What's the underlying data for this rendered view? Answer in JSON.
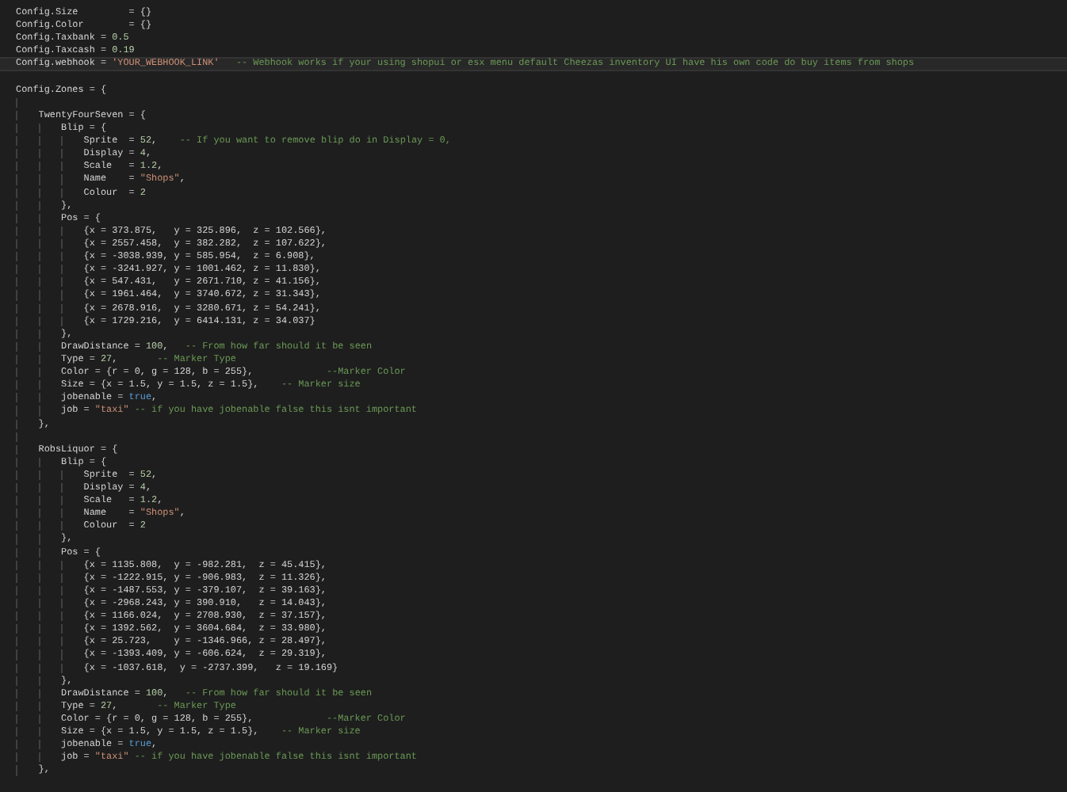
{
  "editor": {
    "lines": [
      {
        "current": false,
        "tokens": [
          {
            "kind": "code",
            "text": "Config.Size         = {}"
          }
        ]
      },
      {
        "current": false,
        "tokens": [
          {
            "kind": "code",
            "text": "Config.Color        = {}"
          }
        ]
      },
      {
        "current": false,
        "tokens": [
          {
            "kind": "code",
            "text": "Config.Taxbank = "
          },
          {
            "kind": "number",
            "text": "0.5"
          }
        ]
      },
      {
        "current": false,
        "tokens": [
          {
            "kind": "code",
            "text": "Config.Taxcash = "
          },
          {
            "kind": "number",
            "text": "0.19"
          }
        ]
      },
      {
        "current": true,
        "tokens": [
          {
            "kind": "code",
            "text": "Config.webhook = "
          },
          {
            "kind": "string",
            "text": "'YOUR_WEBHOOK_LINK'"
          },
          {
            "kind": "comment",
            "text": "   -- Webhook works if your using shopui or esx menu default Cheezas inventory UI have his own code do buy items from shops"
          }
        ]
      },
      {
        "current": false
      },
      {
        "current": false,
        "tokens": [
          {
            "kind": "code",
            "text": "Config.Zones = {"
          }
        ]
      },
      {
        "current": false
      },
      {
        "current": false,
        "tokens": [
          {
            "kind": "code",
            "text": "    TwentyFourSeven = {"
          }
        ]
      },
      {
        "current": false,
        "tokens": [
          {
            "kind": "code",
            "text": "        Blip = {"
          }
        ]
      },
      {
        "current": false,
        "tokens": [
          {
            "kind": "code",
            "text": "            Sprite  = "
          },
          {
            "kind": "number",
            "text": "52"
          },
          {
            "kind": "code",
            "text": ","
          },
          {
            "kind": "comment",
            "text": "    -- If you want to remove blip do in Display = 0,"
          }
        ]
      },
      {
        "current": false,
        "tokens": [
          {
            "kind": "code",
            "text": "            Display = "
          },
          {
            "kind": "number",
            "text": "4"
          },
          {
            "kind": "code",
            "text": ","
          }
        ]
      },
      {
        "current": false,
        "tokens": [
          {
            "kind": "code",
            "text": "            Scale   = "
          },
          {
            "kind": "number",
            "text": "1.2"
          },
          {
            "kind": "code",
            "text": ","
          }
        ]
      },
      {
        "current": false,
        "tokens": [
          {
            "kind": "code",
            "text": "            Name    = "
          },
          {
            "kind": "string",
            "text": "\"Shops\""
          },
          {
            "kind": "code",
            "text": ","
          }
        ]
      },
      {
        "current": false,
        "tokens": [
          {
            "kind": "code",
            "text": "            Colour  = "
          },
          {
            "kind": "number",
            "text": "2"
          }
        ]
      },
      {
        "current": false,
        "tokens": [
          {
            "kind": "code",
            "text": "        },"
          }
        ]
      },
      {
        "current": false,
        "tokens": [
          {
            "kind": "code",
            "text": "        Pos = {"
          }
        ]
      },
      {
        "current": false,
        "tokens": [
          {
            "kind": "code",
            "text": "            {x = 373.875,   y = 325.896,  z = 102.566},"
          }
        ]
      },
      {
        "current": false,
        "tokens": [
          {
            "kind": "code",
            "text": "            {x = 2557.458,  y = 382.282,  z = 107.622},"
          }
        ]
      },
      {
        "current": false,
        "tokens": [
          {
            "kind": "code",
            "text": "            {x = -3038.939, y = 585.954,  z = 6.908},"
          }
        ]
      },
      {
        "current": false,
        "tokens": [
          {
            "kind": "code",
            "text": "            {x = -3241.927, y = 1001.462, z = 11.830},"
          }
        ]
      },
      {
        "current": false,
        "tokens": [
          {
            "kind": "code",
            "text": "            {x = 547.431,   y = 2671.710, z = 41.156},"
          }
        ]
      },
      {
        "current": false,
        "tokens": [
          {
            "kind": "code",
            "text": "            {x = 1961.464,  y = 3740.672, z = 31.343},"
          }
        ]
      },
      {
        "current": false,
        "tokens": [
          {
            "kind": "code",
            "text": "            {x = 2678.916,  y = 3280.671, z = 54.241},"
          }
        ]
      },
      {
        "current": false,
        "tokens": [
          {
            "kind": "code",
            "text": "            {x = 1729.216,  y = 6414.131, z = 34.037}"
          }
        ]
      },
      {
        "current": false,
        "tokens": [
          {
            "kind": "code",
            "text": "        },"
          }
        ]
      },
      {
        "current": false,
        "tokens": [
          {
            "kind": "code",
            "text": "        DrawDistance = "
          },
          {
            "kind": "number",
            "text": "100"
          },
          {
            "kind": "code",
            "text": ","
          },
          {
            "kind": "comment",
            "text": "   -- From how far should it be seen"
          }
        ]
      },
      {
        "current": false,
        "tokens": [
          {
            "kind": "code",
            "text": "        Type = "
          },
          {
            "kind": "number",
            "text": "27"
          },
          {
            "kind": "code",
            "text": ","
          },
          {
            "kind": "comment",
            "text": "       -- Marker Type"
          }
        ]
      },
      {
        "current": false,
        "tokens": [
          {
            "kind": "code",
            "text": "        Color = {r = 0, g = 128, b = 255},"
          },
          {
            "kind": "comment",
            "text": "             --Marker Color"
          }
        ]
      },
      {
        "current": false,
        "tokens": [
          {
            "kind": "code",
            "text": "        Size = {x = 1.5, y = 1.5, z = 1.5},"
          },
          {
            "kind": "comment",
            "text": "    -- Marker size"
          }
        ]
      },
      {
        "current": false,
        "tokens": [
          {
            "kind": "code",
            "text": "        jobenable = "
          },
          {
            "kind": "keyword",
            "text": "true"
          },
          {
            "kind": "code",
            "text": ","
          }
        ]
      },
      {
        "current": false,
        "tokens": [
          {
            "kind": "code",
            "text": "        job = "
          },
          {
            "kind": "string",
            "text": "\"taxi\""
          },
          {
            "kind": "comment",
            "text": " -- if you have jobenable false this isnt important"
          }
        ]
      },
      {
        "current": false,
        "tokens": [
          {
            "kind": "code",
            "text": "    },"
          }
        ]
      },
      {
        "current": false
      },
      {
        "current": false,
        "tokens": [
          {
            "kind": "code",
            "text": "    RobsLiquor = {"
          }
        ]
      },
      {
        "current": false,
        "tokens": [
          {
            "kind": "code",
            "text": "        Blip = {"
          }
        ]
      },
      {
        "current": false,
        "tokens": [
          {
            "kind": "code",
            "text": "            Sprite  = "
          },
          {
            "kind": "number",
            "text": "52"
          },
          {
            "kind": "code",
            "text": ","
          }
        ]
      },
      {
        "current": false,
        "tokens": [
          {
            "kind": "code",
            "text": "            Display = "
          },
          {
            "kind": "number",
            "text": "4"
          },
          {
            "kind": "code",
            "text": ","
          }
        ]
      },
      {
        "current": false,
        "tokens": [
          {
            "kind": "code",
            "text": "            Scale   = "
          },
          {
            "kind": "number",
            "text": "1.2"
          },
          {
            "kind": "code",
            "text": ","
          }
        ]
      },
      {
        "current": false,
        "tokens": [
          {
            "kind": "code",
            "text": "            Name    = "
          },
          {
            "kind": "string",
            "text": "\"Shops\""
          },
          {
            "kind": "code",
            "text": ","
          }
        ]
      },
      {
        "current": false,
        "tokens": [
          {
            "kind": "code",
            "text": "            Colour  = "
          },
          {
            "kind": "number",
            "text": "2"
          }
        ]
      },
      {
        "current": false,
        "tokens": [
          {
            "kind": "code",
            "text": "        },"
          }
        ]
      },
      {
        "current": false,
        "tokens": [
          {
            "kind": "code",
            "text": "        Pos = {"
          }
        ]
      },
      {
        "current": false,
        "tokens": [
          {
            "kind": "code",
            "text": "            {x = 1135.808,  y = -982.281,  z = 45.415},"
          }
        ]
      },
      {
        "current": false,
        "tokens": [
          {
            "kind": "code",
            "text": "            {x = -1222.915, y = -906.983,  z = 11.326},"
          }
        ]
      },
      {
        "current": false,
        "tokens": [
          {
            "kind": "code",
            "text": "            {x = -1487.553, y = -379.107,  z = 39.163},"
          }
        ]
      },
      {
        "current": false,
        "tokens": [
          {
            "kind": "code",
            "text": "            {x = -2968.243, y = 390.910,   z = 14.043},"
          }
        ]
      },
      {
        "current": false,
        "tokens": [
          {
            "kind": "code",
            "text": "            {x = 1166.024,  y = 2708.930,  z = 37.157},"
          }
        ]
      },
      {
        "current": false,
        "tokens": [
          {
            "kind": "code",
            "text": "            {x = 1392.562,  y = 3604.684,  z = 33.980},"
          }
        ]
      },
      {
        "current": false,
        "tokens": [
          {
            "kind": "code",
            "text": "            {x = 25.723,    y = -1346.966, z = 28.497},"
          }
        ]
      },
      {
        "current": false,
        "tokens": [
          {
            "kind": "code",
            "text": "            {x = -1393.409, y = -606.624,  z = 29.319},"
          }
        ]
      },
      {
        "current": false,
        "tokens": [
          {
            "kind": "code",
            "text": "            {x = -1037.618,  y = -2737.399,   z = 19.169}"
          }
        ]
      },
      {
        "current": false,
        "tokens": [
          {
            "kind": "code",
            "text": "        },"
          }
        ]
      },
      {
        "current": false,
        "tokens": [
          {
            "kind": "code",
            "text": "        DrawDistance = "
          },
          {
            "kind": "number",
            "text": "100"
          },
          {
            "kind": "code",
            "text": ","
          },
          {
            "kind": "comment",
            "text": "   -- From how far should it be seen"
          }
        ]
      },
      {
        "current": false,
        "tokens": [
          {
            "kind": "code",
            "text": "        Type = "
          },
          {
            "kind": "number",
            "text": "27"
          },
          {
            "kind": "code",
            "text": ","
          },
          {
            "kind": "comment",
            "text": "       -- Marker Type"
          }
        ]
      },
      {
        "current": false,
        "tokens": [
          {
            "kind": "code",
            "text": "        Color = {r = 0, g = 128, b = 255},"
          },
          {
            "kind": "comment",
            "text": "             --Marker Color"
          }
        ]
      },
      {
        "current": false,
        "tokens": [
          {
            "kind": "code",
            "text": "        Size = {x = 1.5, y = 1.5, z = 1.5},"
          },
          {
            "kind": "comment",
            "text": "    -- Marker size"
          }
        ]
      },
      {
        "current": false,
        "tokens": [
          {
            "kind": "code",
            "text": "        jobenable = "
          },
          {
            "kind": "keyword",
            "text": "true"
          },
          {
            "kind": "code",
            "text": ","
          }
        ]
      },
      {
        "current": false,
        "tokens": [
          {
            "kind": "code",
            "text": "        job = "
          },
          {
            "kind": "string",
            "text": "\"taxi\""
          },
          {
            "kind": "comment",
            "text": " -- if you have jobenable false this isnt important"
          }
        ]
      },
      {
        "current": false,
        "tokens": [
          {
            "kind": "code",
            "text": "    },"
          }
        ]
      }
    ]
  }
}
